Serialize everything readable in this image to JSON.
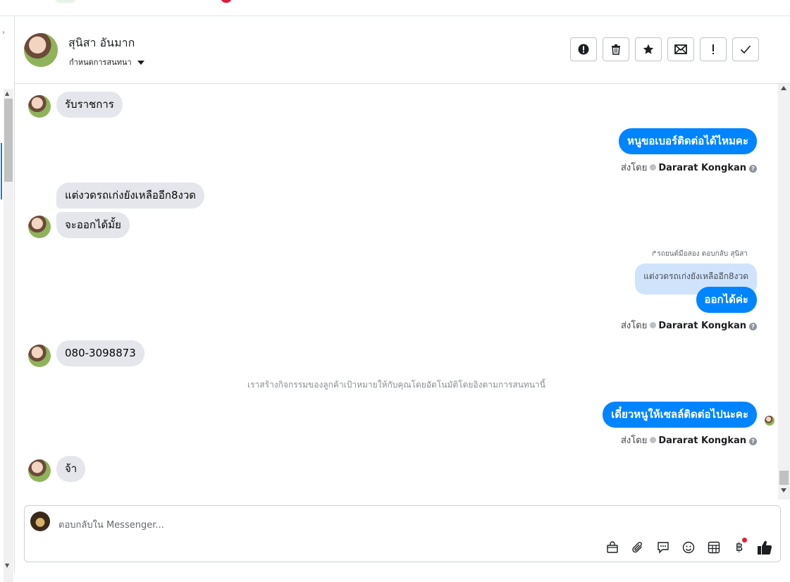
{
  "conversation": {
    "contact_name": "สุนิสา อันมาก",
    "assign_label": "กำหนดการสนทนา"
  },
  "actions": [
    {
      "name": "spam-button",
      "icon": "exclamation-circle-icon"
    },
    {
      "name": "delete-button",
      "icon": "trash-icon"
    },
    {
      "name": "star-button",
      "icon": "star-icon"
    },
    {
      "name": "mark-unread-button",
      "icon": "envelope-icon"
    },
    {
      "name": "follow-up-button",
      "icon": "exclamation-icon"
    },
    {
      "name": "done-button",
      "icon": "checkmark-icon"
    }
  ],
  "messages": {
    "m1": "รับราชการ",
    "m2": "หนูขอเบอร์ติดต่อได้ไหมคะ",
    "m3": "แต่งวดรถเก่งยังเหลืออีก8งวด",
    "m4": "จะออกได้มั้ย",
    "m5_reply_note": "รถยนต์มือสอง ตอบกลับ สุนิสา",
    "m5_quoted": "แต่งวดรถเก่งยังเหลืออีก8งวด",
    "m5": "ออกได้ค่ะ",
    "m6": "080-3098873",
    "system_note": "เราสร้างกิจกรรมของลูกค้าเป้าหมายให้กับคุณโดยอัตโนมัติโดยอิงตามการสนทนานี้",
    "m7": "เดี๋ยวหนูให้เซลล์ติดต่อไปนะคะ",
    "m8": "จ้า"
  },
  "sent_by": {
    "prefix": "ส่งโดย",
    "agent": "Dararat Kongkan"
  },
  "composer": {
    "placeholder": "ตอบกลับใน Messenger..."
  },
  "composer_tools": [
    "shop-bag-icon",
    "paperclip-icon",
    "chat-reply-icon",
    "emoji-icon",
    "table-icon",
    "baht-icon",
    "thumbs-up-icon"
  ],
  "colors": {
    "outgoing": "#0084ff",
    "incoming": "#e4e6eb",
    "quoted": "#cfe3fb"
  }
}
